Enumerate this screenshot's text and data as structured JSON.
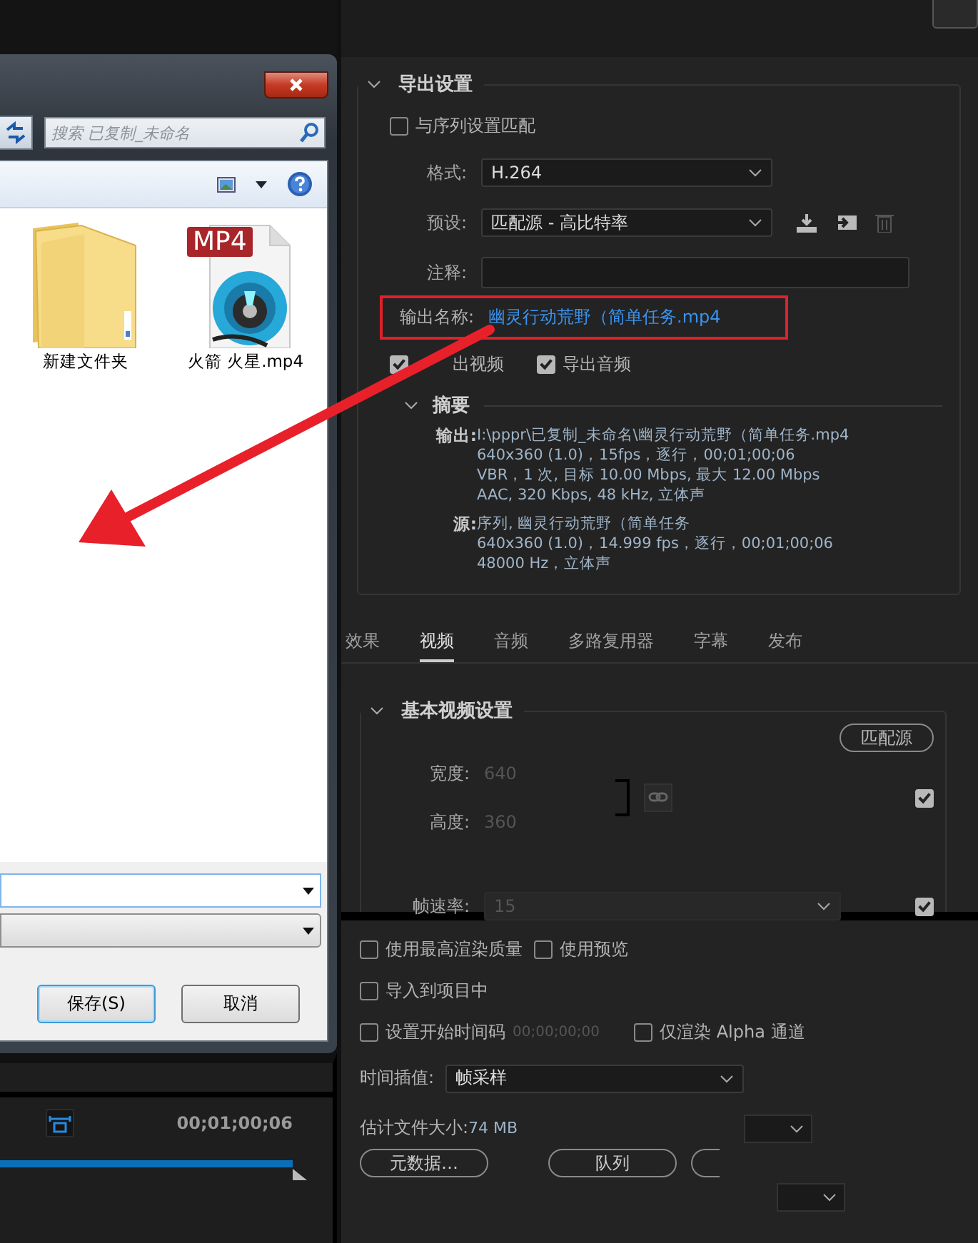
{
  "dialog": {
    "search_placeholder": "搜索 已复制_未命名",
    "files": [
      {
        "name": "新建文件夹",
        "kind": "folder"
      },
      {
        "name": "火箭 火星.mp4",
        "kind": "video",
        "badge": "MP4"
      }
    ],
    "buttons": [
      {
        "label": "保存(S)",
        "default": true
      },
      {
        "label": "取消",
        "default": false
      }
    ]
  },
  "timeline": {
    "timecode": "00;01;00;06"
  },
  "export_settings": {
    "title": "导出设置",
    "match_sequence": {
      "label": "与序列设置匹配",
      "checked": false
    },
    "fields": [
      {
        "label": "格式:",
        "kind": "dropdown",
        "value": "H.264"
      },
      {
        "label": "预设:",
        "kind": "preset",
        "value": "匹配源 - 高比特率"
      },
      {
        "label": "注释:",
        "kind": "text"
      }
    ],
    "output_name": {
      "label": "输出名称:",
      "value": "幽灵行动荒野（简单任务.mp4"
    },
    "export_checks": [
      {
        "label": "出视频",
        "checked": true
      },
      {
        "label": "导出音频",
        "checked": true
      }
    ],
    "summary": {
      "title": "摘要",
      "output_label": "输出:",
      "output_lines": [
        "I:\\pppr\\已复制_未命名\\幽灵行动荒野（简单任务.mp4",
        "640x360 (1.0)，15fps，逐行，00;01;00;06",
        "VBR，1 次, 目标 10.00 Mbps, 最大 12.00 Mbps",
        "AAC, 320 Kbps, 48 kHz, 立体声"
      ],
      "source_label": "源:",
      "source_lines": [
        "序列, 幽灵行动荒野（简单任务",
        "640x360 (1.0)，14.999 fps，逐行，00;01;00;06",
        "48000 Hz，立体声"
      ]
    }
  },
  "tabs": [
    {
      "label": "效果",
      "selected": false
    },
    {
      "label": "视频",
      "selected": true
    },
    {
      "label": "音频",
      "selected": false
    },
    {
      "label": "多路复用器",
      "selected": false
    },
    {
      "label": "字幕",
      "selected": false
    },
    {
      "label": "发布",
      "selected": false
    }
  ],
  "basic_video": {
    "title": "基本视频设置",
    "match_button": "匹配源",
    "width": {
      "label": "宽度:",
      "value": "640",
      "disabled": true
    },
    "height": {
      "label": "高度:",
      "value": "360",
      "disabled": true
    },
    "size_checked": true,
    "frame_rate": {
      "label": "帧速率:",
      "value": "15",
      "checked": true
    }
  },
  "options": [
    {
      "label": "使用最高渲染质量",
      "checked": false
    },
    {
      "label": "使用预览",
      "checked": false
    },
    {
      "label": "导入到项目中",
      "checked": false
    },
    {
      "label": "设置开始时间码",
      "checked": false,
      "value": "00;00;00;00"
    },
    {
      "label": "仅渲染 Alpha 通道",
      "checked": false
    }
  ],
  "interpolation": {
    "label": "时间插值:",
    "value": "帧采样"
  },
  "file_size": {
    "label": "估计文件大小:",
    "value": "74 MB"
  },
  "buttons": [
    "元数据…",
    "队列"
  ]
}
